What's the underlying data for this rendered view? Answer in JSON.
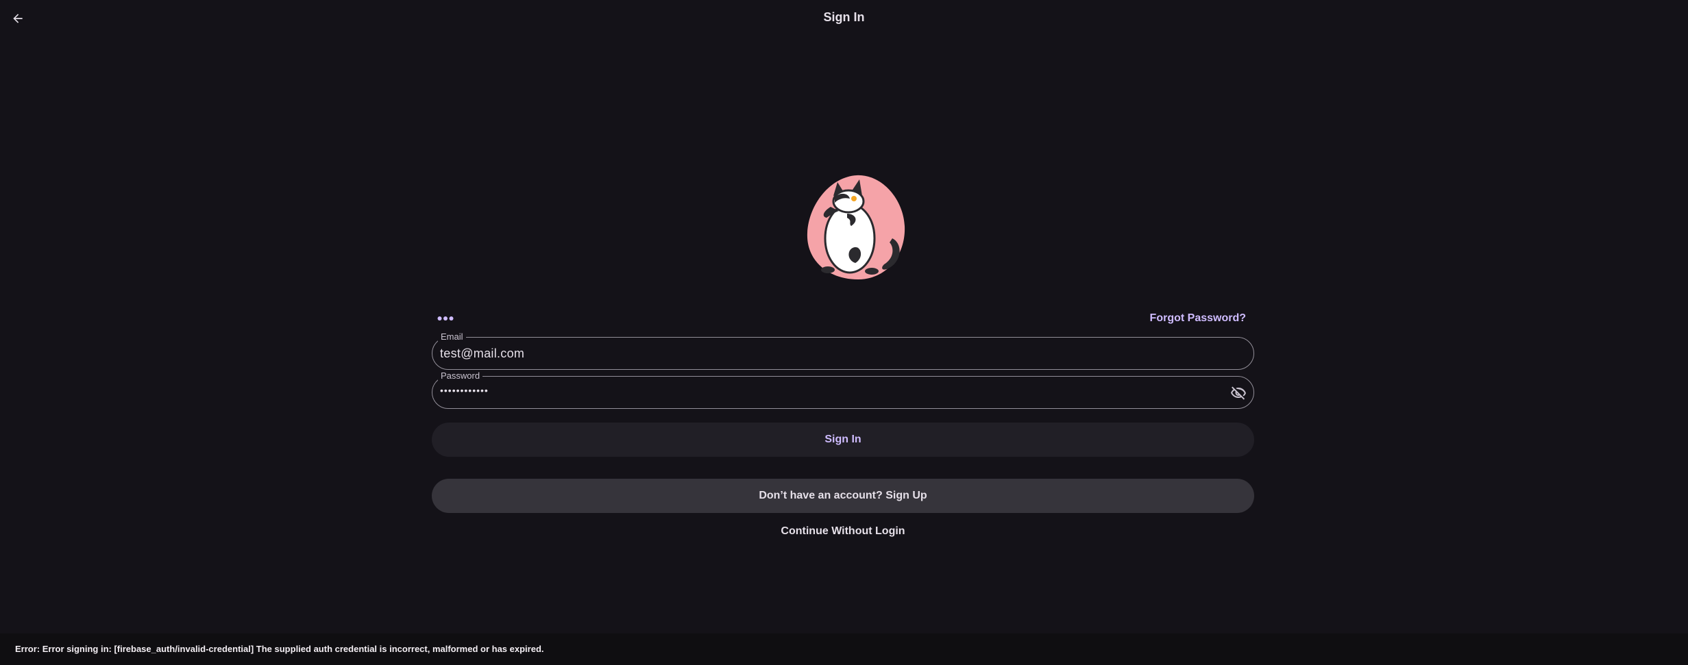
{
  "app_bar": {
    "title": "Sign In",
    "back_icon": "arrow-left-icon"
  },
  "illustration": {
    "icon": "cat-mascot-illustration",
    "blob_color": "#f5a3a8"
  },
  "form": {
    "indicator_icon": "dots-icon",
    "forgot_password_label": "Forgot Password?",
    "email": {
      "label": "Email",
      "value": "test@mail.com"
    },
    "password": {
      "label": "Password",
      "value": "••••••••••••",
      "toggle_icon": "eye-off-icon"
    },
    "sign_in_label": "Sign In",
    "sign_up_label": "Don’t have an account? Sign Up",
    "continue_label": "Continue Without Login"
  },
  "snackbar": {
    "message": "Error: Error signing in: [firebase_auth/invalid-credential] The supplied auth credential is incorrect, malformed or has expired."
  },
  "colors": {
    "background": "#141218",
    "accent": "#cfbcff",
    "outline": "#938f99",
    "surface_button": "#211f26",
    "tonal_button": "#36343b"
  }
}
